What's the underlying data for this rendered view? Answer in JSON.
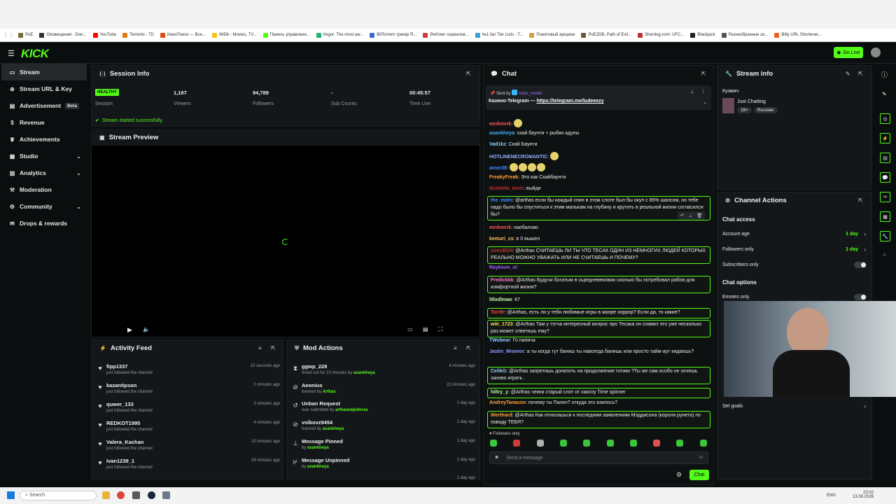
{
  "bookmarks": [
    {
      "label": "PoE",
      "color": "#7a6a3a"
    },
    {
      "label": "Оповещения - Don...",
      "color": "#333"
    },
    {
      "label": "YouTube",
      "color": "#ff0000"
    },
    {
      "label": "Torrents - TD",
      "color": "#e07a10"
    },
    {
      "label": "КиноПоиск — Все...",
      "color": "#e04a10"
    },
    {
      "label": "IMDb - Movies, TV...",
      "color": "#f5c518"
    },
    {
      "label": "Панель управлени...",
      "color": "#53fc18"
    },
    {
      "label": "Imgur: The most aw...",
      "color": "#1bb76e"
    },
    {
      "label": "BitTorrent трекер R...",
      "color": "#3a6ad0"
    },
    {
      "label": "Рейтинг сериалов...",
      "color": "#d03a3a"
    },
    {
      "label": "№1 fan Tier Lists - T...",
      "color": "#3aa0d0"
    },
    {
      "label": "Понятовый аукцион",
      "color": "#d0a03a"
    },
    {
      "label": "PoE2DB, Path of Exil...",
      "color": "#6a5a3a"
    },
    {
      "label": "Sherdog.com: UFC...",
      "color": "#c03030"
    },
    {
      "label": "Blackjack",
      "color": "#222"
    },
    {
      "label": "Разнообразные си...",
      "color": "#555"
    },
    {
      "label": "Bitly URL Shortener...",
      "color": "#ee6123"
    }
  ],
  "header": {
    "logo": "KICK",
    "go_live": "Go Live"
  },
  "sidebar": {
    "items": [
      {
        "label": "Stream",
        "icon": "screen-icon"
      },
      {
        "label": "Stream URL & Key",
        "icon": "globe-icon"
      },
      {
        "label": "Advertisement",
        "badge": "Beta",
        "icon": "ad-icon"
      },
      {
        "label": "Revenue",
        "icon": "dollar-icon"
      },
      {
        "label": "Achievements",
        "icon": "trophy-icon"
      },
      {
        "label": "Studio",
        "icon": "studio-icon"
      },
      {
        "label": "Analytics",
        "icon": "chart-icon"
      },
      {
        "label": "Moderation",
        "icon": "hammer-icon"
      },
      {
        "label": "Community",
        "icon": "gear-icon"
      },
      {
        "label": "Drops & rewards",
        "icon": "gift-icon"
      }
    ]
  },
  "session": {
    "title": "Session Info",
    "status": "HEALTHY",
    "stats": [
      {
        "value": "HEALTHY",
        "label": "Session"
      },
      {
        "value": "1,187",
        "label": "Viewers"
      },
      {
        "value": "94,789",
        "label": "Followers"
      },
      {
        "value": "-",
        "label": "Sub Counts"
      },
      {
        "value": "00:45:57",
        "label": "Time Live"
      }
    ],
    "message": "Stream started successfully."
  },
  "preview": {
    "title": "Stream Preview"
  },
  "activity": {
    "title": "Activity Feed",
    "items": [
      {
        "name": "fipp1337",
        "sub": "just followed the channel",
        "time": "10 seconds ago"
      },
      {
        "name": "kazantipson",
        "sub": "just followed the channel",
        "time": "2 minutes ago"
      },
      {
        "name": "quwer_133",
        "sub": "just followed the channel",
        "time": "3 minutes ago"
      },
      {
        "name": "REDKOT1995",
        "sub": "just followed the channel",
        "time": "4 minutes ago"
      },
      {
        "name": "Valera_Kachan",
        "sub": "just followed the channel",
        "time": "10 minutes ago"
      },
      {
        "name": "Ivan1239_1",
        "sub": "just followed the channel",
        "time": "19 minutes ago"
      }
    ]
  },
  "mod": {
    "title": "Mod Actions",
    "items": [
      {
        "name": "ggwp_228",
        "sub": "timed out for 10 minutes by",
        "by": "asankheya",
        "time": "4 minutes ago",
        "icon": "hourglass-icon"
      },
      {
        "name": "Aeonius",
        "sub": "banned by",
        "by": "Arthas",
        "time": "22 minutes ago",
        "icon": "ban-icon"
      },
      {
        "name": "Unban Request",
        "sub": "was submitted by",
        "by": "arthasnepidoras",
        "time": "1 day ago",
        "icon": "undo-icon"
      },
      {
        "name": "volkovz9454",
        "sub": "banned by",
        "by": "asankheya",
        "time": "1 day ago",
        "icon": "ban-icon"
      },
      {
        "name": "Message Pinned",
        "sub": "by",
        "by": "asankheya",
        "time": "1 day ago",
        "icon": "pin-icon"
      },
      {
        "name": "Message Unpinned",
        "sub": "by",
        "by": "asankheya",
        "time": "1 day ago",
        "icon": "unpin-icon"
      },
      {
        "name": "",
        "sub": "",
        "by": "",
        "time": "1 day ago",
        "icon": ""
      }
    ]
  },
  "chat": {
    "title": "Chat",
    "pinned_by": "Sent by",
    "pinned_user": "nedo_moder",
    "pinned_text": "Казино-Telegram — ",
    "pinned_link": "https://telegram.me/ludeeezy",
    "messages": [
      {
        "user": "mrrkmrrk",
        "color": "#ff5a5a",
        "text": "",
        "emotes": 1,
        "hl": false
      },
      {
        "user": "asankheya",
        "color": "#38b6ff",
        "text": "скай баунти + рыбки адуны",
        "hl": false
      },
      {
        "user": "Vad1kz",
        "color": "#8fd0ff",
        "text": "Скай Баунти",
        "hl": false
      },
      {
        "user": "HOTLINENECROMANTIC",
        "color": "#8fb0ff",
        "text": "",
        "emotes": 1,
        "hl": false
      },
      {
        "user": "amor38",
        "color": "#3a8cff",
        "text": "",
        "emotes": 4,
        "hl": false
      },
      {
        "user": "FreakyFreak",
        "color": "#ffa040",
        "text": "Это как Скайбаунти",
        "hl": false
      },
      {
        "user": "dushnila_toxic",
        "color": "#c03030",
        "text": "выйди",
        "hl": false
      },
      {
        "user": "the_mdm",
        "color": "#3a8cff",
        "text": "@arthas если бы каждый спин в этом слоте был бы окуп с 85% шансом, но тебе надо было бы спуститься к этим малькам на глубину и крутить в реальной жизни согласился бы?",
        "hl": true
      },
      {
        "user": "mrrkmrrk",
        "color": "#ff5a5a",
        "text": "наебалово",
        "hl": false
      },
      {
        "user": "kemuri_cs",
        "color": "#ffc060",
        "text": "в 0 вышел",
        "hl": false
      },
      {
        "user": "sinis8524",
        "color": "#c03030",
        "text": "@Arthas СЧИТАЕШЬ ЛИ ТЫ ЧТО ТЕСАК ОДИН ИЗ НЕМНОГИХ ЛЮДЕЙ КОТОРЫХ РЕАЛЬНО МОЖНО УВАЖАТЬ ИЛИ НЕ СЧИТАЕШЬ И ПОЧЕМУ?",
        "hl": true
      },
      {
        "user": "Raykium_xl",
        "color": "#a060ff",
        "text": "",
        "hl": false
      },
      {
        "user": "Fredickkk",
        "color": "#ff7ad0",
        "text": "@Arthas Будучи богатым в сьредневековии сколько бы потребовал рабов для комфортной жизни?",
        "hl": true
      },
      {
        "user": "l0lxdlmao",
        "color": "#c8ffb0",
        "text": "67",
        "hl": false
      },
      {
        "user": "Tor3tr",
        "color": "#ff4040",
        "text": "@Arthas, есть ли у тебя любимые игры в жанре хоррор? Если да, то какие?",
        "hl": true
      },
      {
        "user": "wiir_1723",
        "color": "#ffe060",
        "text": "@Arthas Там у тэтча интересный вопрос про Тесака он спамит его уже несколько раз может ответишь ему?",
        "hl": true
      },
      {
        "user": "TWobear",
        "color": "#8fd0ff",
        "text": "Го папича",
        "hl": false
      },
      {
        "user": "Jastin_Mramor",
        "color": "#8f9cff",
        "text": "а ты когда тут баниш ты навсегда банишь или просто тайм-аут кидаешь?",
        "hl": false
      },
      {
        "user": "CelikG",
        "color": "#8fd0ff",
        "text": "@Arthas запретишь донатить на продолжение готики ?Ты же сам особо не хочешь заново играть .",
        "hl": true
      },
      {
        "user": "hiltry_y",
        "color": "#b0ff90",
        "text": "@Arthas чекни старый слот от хаксоу Time spinner",
        "hl": true
      },
      {
        "user": "AndreyTanasov",
        "color": "#ffa040",
        "text": "почему ты Папич? откуда это взялось?",
        "hl": false
      },
      {
        "user": "Werthard",
        "color": "#ffa040",
        "text": "@Arthas Как относишься к последним заявлениям Мэддисона (короля рунета) по поводу ТЕБЯ?",
        "hl": true
      }
    ],
    "followers_only": "Followers only",
    "input_placeholder": "Send a message",
    "send_label": "Chat"
  },
  "stream_info": {
    "title": "Stream info",
    "streamer": "Кузмич",
    "category": "Just Chatting",
    "tags": [
      "18+",
      "Russian"
    ]
  },
  "channel_actions": {
    "title": "Channel Actions",
    "access_title": "Chat access",
    "rows": [
      {
        "label": "Account age",
        "value": "1 day"
      },
      {
        "label": "Followers only",
        "value": "1 day"
      },
      {
        "label": "Subscribers only",
        "value": ""
      }
    ],
    "options_title": "Chat options",
    "emotes_only": "Emotes only",
    "set_goals": "Set goals"
  },
  "taskbar": {
    "search": "Search",
    "lang": "ENG",
    "time": "23:02",
    "date": "13.08.2026"
  }
}
